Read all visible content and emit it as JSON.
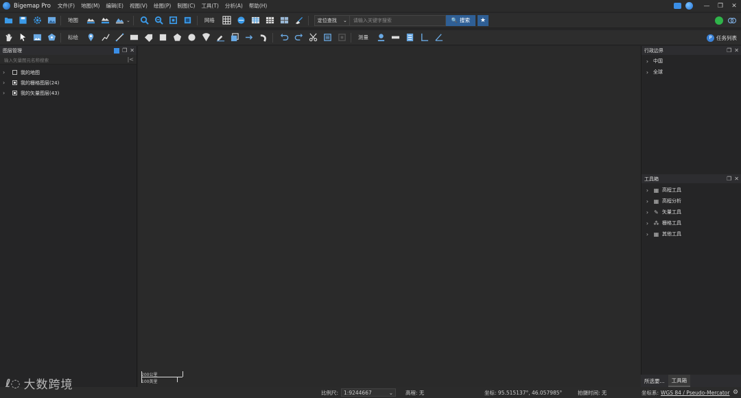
{
  "app": {
    "title": "Bigemap Pro",
    "menu": [
      "文件(F)",
      "地图(M)",
      "编辑(E)",
      "视图(V)",
      "绘图(P)",
      "制图(C)",
      "工具(T)",
      "分析(A)",
      "帮助(H)"
    ],
    "window_controls": [
      "—",
      "❐",
      "✕"
    ]
  },
  "toolbar1": {
    "map_label": "地图",
    "grid_label": "网格",
    "search_mode": "定位查找",
    "search_placeholder": "请输入关键字搜索",
    "search_button": "搜索",
    "star_glyph": "★",
    "search_glyph": "🔍",
    "dropdown_glyph": "⌄"
  },
  "toolbar2": {
    "mark_label": "标绘",
    "measure_label": "测量",
    "task_list": "任务列表",
    "task_glyph": "P"
  },
  "left_panel": {
    "title": "图层管理",
    "search_placeholder": "输入矢量图元名称搜索",
    "search_end_glyph": "|<",
    "items": [
      {
        "label": "我的地图",
        "checked": false
      },
      {
        "label": "我的栅格图层(24)",
        "checked": true
      },
      {
        "label": "我的矢量图层(43)",
        "checked": true
      }
    ]
  },
  "admin_panel": {
    "title": "行政边界",
    "items": [
      "中国",
      "全球"
    ]
  },
  "toolbox_panel": {
    "title": "工具箱",
    "items": [
      {
        "label": "高程工具",
        "icon": "grid-icon"
      },
      {
        "label": "高程分析",
        "icon": "grid-icon"
      },
      {
        "label": "矢量工具",
        "icon": "pen-icon"
      },
      {
        "label": "栅格工具",
        "icon": "nodes-icon"
      },
      {
        "label": "其他工具",
        "icon": "grid-icon"
      }
    ]
  },
  "right_tabs": [
    "所选要...",
    "工具箱"
  ],
  "map": {
    "scale_top": "200公里",
    "scale_bottom": "100英里"
  },
  "status": {
    "scale_label": "比例尺:",
    "scale_value": "1:9244667",
    "elevation": "高程: 无",
    "coords": "坐标: 95.515137°, 46.057985°",
    "capture_time": "拍摄时间: 无",
    "crs_label": "坐标系:",
    "crs_value": "WGS 84 / Pseudo-Mercator"
  },
  "watermark": {
    "logo": "ℓ◌",
    "text": "大数跨境"
  },
  "colors": {
    "accent": "#2f5f95",
    "background": "#252526"
  }
}
